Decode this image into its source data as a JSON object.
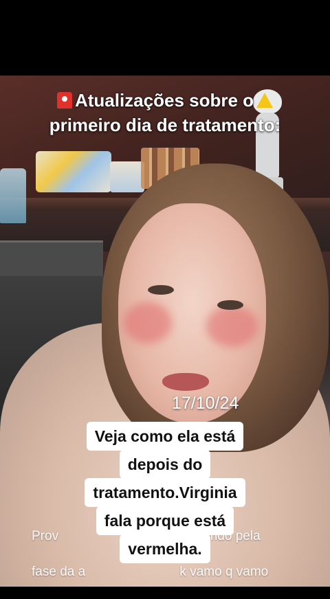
{
  "headline": {
    "line1": "Atualizações sobre o",
    "line2": "primeiro dia de tratamento:",
    "icon_left": "alarm-icon",
    "icon_right": "warning-icon"
  },
  "date": "17/10/24",
  "background_caption": {
    "line1": "Prov                                      sando pela",
    "line2": "fase da a                          k vamo q vamo"
  },
  "caption": {
    "lines": [
      "Veja como ela está",
      "depois do",
      "tratamento.Virginia",
      "fala porque está",
      "vermelha."
    ]
  },
  "colors": {
    "caption_bg": "#ffffff",
    "caption_text": "#111111",
    "alarm": "#e0312d",
    "warning": "#f5c518"
  }
}
